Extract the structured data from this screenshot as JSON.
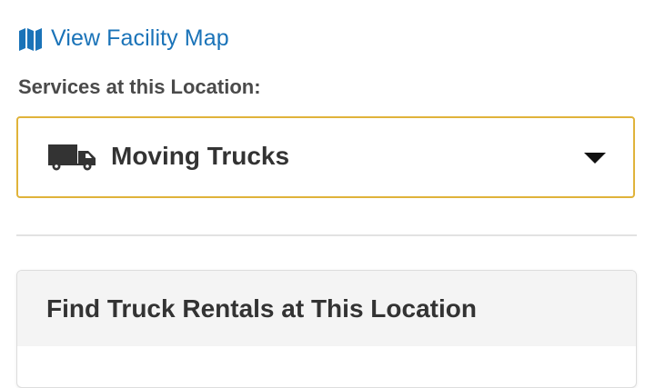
{
  "facility_map_link": {
    "label": "View Facility Map",
    "icon": "map-icon",
    "color": "#1a73b8"
  },
  "services": {
    "label": "Services at this Location:",
    "selected": {
      "label": "Moving Trucks",
      "icon": "truck-icon"
    },
    "accent_border": "#e0b33a"
  },
  "rentals_card": {
    "title": "Find Truck Rentals at This Location"
  }
}
